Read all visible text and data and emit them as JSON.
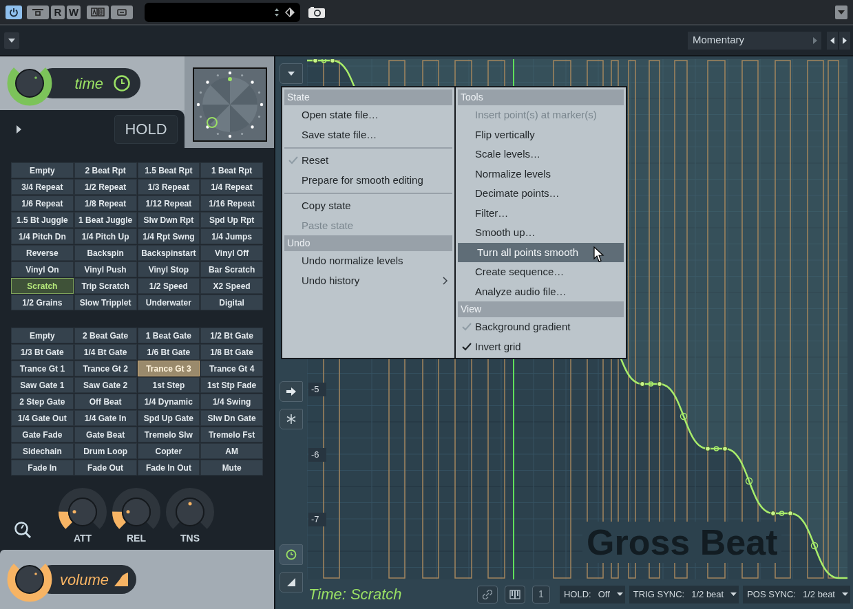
{
  "toolbar": {
    "buttons": [
      {
        "kind": "power",
        "on": true
      },
      {
        "kind": "window"
      },
      {
        "kind": "letter",
        "label": "R"
      },
      {
        "kind": "letter",
        "label": "W"
      },
      {
        "kind": "compare"
      },
      {
        "kind": "menu"
      }
    ]
  },
  "preset_bar": {
    "mode": "Momentary"
  },
  "time_section": {
    "label": "time",
    "hold": "HOLD"
  },
  "time_presets": {
    "kind": "time",
    "cells": [
      {
        "label": "Empty",
        "selected": false
      },
      {
        "label": "2 Beat Rpt",
        "selected": false
      },
      {
        "label": "1.5 Beat Rpt",
        "selected": false
      },
      {
        "label": "1 Beat Rpt",
        "selected": false
      },
      {
        "label": "3/4 Repeat",
        "selected": false
      },
      {
        "label": "1/2 Repeat",
        "selected": false
      },
      {
        "label": "1/3 Repeat",
        "selected": false
      },
      {
        "label": "1/4 Repeat",
        "selected": false
      },
      {
        "label": "1/6 Repeat",
        "selected": false
      },
      {
        "label": "1/8 Repeat",
        "selected": false
      },
      {
        "label": "1/12 Repeat",
        "selected": false
      },
      {
        "label": "1/16 Repeat",
        "selected": false
      },
      {
        "label": "1.5 Bt Juggle",
        "selected": false
      },
      {
        "label": "1 Beat Juggle",
        "selected": false
      },
      {
        "label": "Slw Dwn Rpt",
        "selected": false
      },
      {
        "label": "Spd Up Rpt",
        "selected": false
      },
      {
        "label": "1/4 Pitch Dn",
        "selected": false
      },
      {
        "label": "1/4 Pitch Up",
        "selected": false
      },
      {
        "label": "1/4 Rpt Swng",
        "selected": false
      },
      {
        "label": "1/4 Jumps",
        "selected": false
      },
      {
        "label": "Reverse",
        "selected": false
      },
      {
        "label": "Backspin",
        "selected": false
      },
      {
        "label": "Backspinstart",
        "selected": false
      },
      {
        "label": "Vinyl Off",
        "selected": false
      },
      {
        "label": "Vinyl On",
        "selected": false
      },
      {
        "label": "Vinyl Push",
        "selected": false
      },
      {
        "label": "Vinyl Stop",
        "selected": false
      },
      {
        "label": "Bar Scratch",
        "selected": false
      },
      {
        "label": "Scratch",
        "selected": true
      },
      {
        "label": "Trip Scratch",
        "selected": false
      },
      {
        "label": "1/2 Speed",
        "selected": false
      },
      {
        "label": "X2 Speed",
        "selected": false
      },
      {
        "label": "1/2 Grains",
        "selected": false
      },
      {
        "label": "Slow Tripplet",
        "selected": false
      },
      {
        "label": "Underwater",
        "selected": false
      },
      {
        "label": "Digital",
        "selected": false
      }
    ]
  },
  "volume_presets": {
    "kind": "volume",
    "cells": [
      {
        "label": "Empty",
        "selected": false
      },
      {
        "label": "2 Beat Gate",
        "selected": false
      },
      {
        "label": "1 Beat Gate",
        "selected": false
      },
      {
        "label": "1/2 Bt Gate",
        "selected": false
      },
      {
        "label": "1/3 Bt Gate",
        "selected": false
      },
      {
        "label": "1/4 Bt Gate",
        "selected": false
      },
      {
        "label": "1/6 Bt Gate",
        "selected": false
      },
      {
        "label": "1/8 Bt Gate",
        "selected": false
      },
      {
        "label": "Trance Gt 1",
        "selected": false
      },
      {
        "label": "Trance Gt 2",
        "selected": false
      },
      {
        "label": "Trance Gt 3",
        "selected": true
      },
      {
        "label": "Trance Gt 4",
        "selected": false
      },
      {
        "label": "Saw Gate 1",
        "selected": false
      },
      {
        "label": "Saw Gate 2",
        "selected": false
      },
      {
        "label": "1st Step",
        "selected": false
      },
      {
        "label": "1st Stp Fade",
        "selected": false
      },
      {
        "label": "2 Step Gate",
        "selected": false
      },
      {
        "label": "Off Beat",
        "selected": false
      },
      {
        "label": "1/4 Dynamic",
        "selected": false
      },
      {
        "label": "1/4 Swing",
        "selected": false
      },
      {
        "label": "1/4 Gate Out",
        "selected": false
      },
      {
        "label": "1/4 Gate In",
        "selected": false
      },
      {
        "label": "Spd Up Gate",
        "selected": false
      },
      {
        "label": "Slw Dn Gate",
        "selected": false
      },
      {
        "label": "Gate Fade",
        "selected": false
      },
      {
        "label": "Gate Beat",
        "selected": false
      },
      {
        "label": "Tremelo Slw",
        "selected": false
      },
      {
        "label": "Tremelo Fst",
        "selected": false
      },
      {
        "label": "Sidechain",
        "selected": false
      },
      {
        "label": "Drum Loop",
        "selected": false
      },
      {
        "label": "Copter",
        "selected": false
      },
      {
        "label": "AM",
        "selected": false
      },
      {
        "label": "Fade In",
        "selected": false
      },
      {
        "label": "Fade Out",
        "selected": false
      },
      {
        "label": "Fade In Out",
        "selected": false
      },
      {
        "label": "Mute",
        "selected": false
      }
    ]
  },
  "knobs": [
    {
      "label": "ATT",
      "kind": "unipolar",
      "level": 0.17
    },
    {
      "label": "REL",
      "kind": "unipolar",
      "level": 0.17
    },
    {
      "label": "TNS",
      "kind": "bipolar",
      "level": 0.5
    }
  ],
  "volume_section": {
    "label": "volume"
  },
  "graph": {
    "y_labels": [
      "-5",
      "-6",
      "-7"
    ],
    "logo": "Gross Beat",
    "status": "Time: Scratch",
    "tools": [
      {
        "kind": "link"
      },
      {
        "kind": "piano"
      },
      {
        "kind": "text",
        "label": "1"
      }
    ],
    "selectors": [
      {
        "label": "HOLD:",
        "value": "Off"
      },
      {
        "label": "TRIG SYNC:",
        "value": "1/2 beat"
      },
      {
        "label": "POS SYNC:",
        "value": "1/2 beat"
      }
    ]
  },
  "menu": {
    "columns": [
      {
        "entries": [
          {
            "kind": "header",
            "label": "State"
          },
          {
            "kind": "item",
            "label": "Open state file…",
            "checked": false,
            "disabled": false,
            "highlighted": false,
            "submenu": false
          },
          {
            "kind": "item",
            "label": "Save state file…",
            "checked": false,
            "disabled": false,
            "highlighted": false,
            "submenu": false
          },
          {
            "kind": "separator"
          },
          {
            "kind": "item",
            "label": "Reset",
            "checked": true,
            "check_dim": true,
            "disabled": false,
            "highlighted": false,
            "submenu": false
          },
          {
            "kind": "item",
            "label": "Prepare for smooth editing",
            "checked": false,
            "disabled": false,
            "highlighted": false,
            "submenu": false
          },
          {
            "kind": "separator"
          },
          {
            "kind": "item",
            "label": "Copy state",
            "checked": false,
            "disabled": false,
            "highlighted": false,
            "submenu": false
          },
          {
            "kind": "item",
            "label": "Paste state",
            "checked": false,
            "disabled": true,
            "highlighted": false,
            "submenu": false
          },
          {
            "kind": "header",
            "label": "Undo"
          },
          {
            "kind": "item",
            "label": "Undo normalize levels",
            "checked": false,
            "disabled": false,
            "highlighted": false,
            "submenu": false
          },
          {
            "kind": "item",
            "label": "Undo history",
            "checked": false,
            "disabled": false,
            "highlighted": false,
            "submenu": true
          }
        ]
      },
      {
        "entries": [
          {
            "kind": "header",
            "label": "Tools"
          },
          {
            "kind": "item",
            "label": "Insert point(s) at marker(s)",
            "checked": false,
            "disabled": true,
            "highlighted": false,
            "submenu": false
          },
          {
            "kind": "item",
            "label": "Flip vertically",
            "checked": false,
            "disabled": false,
            "highlighted": false,
            "submenu": false
          },
          {
            "kind": "item",
            "label": "Scale levels…",
            "checked": false,
            "disabled": false,
            "highlighted": false,
            "submenu": false
          },
          {
            "kind": "item",
            "label": "Normalize levels",
            "checked": false,
            "disabled": false,
            "highlighted": false,
            "submenu": false
          },
          {
            "kind": "item",
            "label": "Decimate points…",
            "checked": false,
            "disabled": false,
            "highlighted": false,
            "submenu": false
          },
          {
            "kind": "item",
            "label": "Filter…",
            "checked": false,
            "disabled": false,
            "highlighted": false,
            "submenu": false
          },
          {
            "kind": "item",
            "label": "Smooth up…",
            "checked": false,
            "disabled": false,
            "highlighted": false,
            "submenu": false
          },
          {
            "kind": "item",
            "label": "Turn all points smooth",
            "checked": false,
            "disabled": false,
            "highlighted": true,
            "submenu": false
          },
          {
            "kind": "item",
            "label": "Create sequence…",
            "checked": false,
            "disabled": false,
            "highlighted": false,
            "submenu": false
          },
          {
            "kind": "item",
            "label": "Analyze audio file…",
            "checked": false,
            "disabled": false,
            "highlighted": false,
            "submenu": false
          },
          {
            "kind": "header",
            "label": "View"
          },
          {
            "kind": "item",
            "label": "Background gradient",
            "checked": true,
            "check_dim": true,
            "disabled": false,
            "highlighted": false,
            "submenu": false
          },
          {
            "kind": "item",
            "label": "Invert grid",
            "checked": true,
            "check_dim": false,
            "disabled": false,
            "highlighted": false,
            "submenu": false
          }
        ]
      }
    ]
  }
}
